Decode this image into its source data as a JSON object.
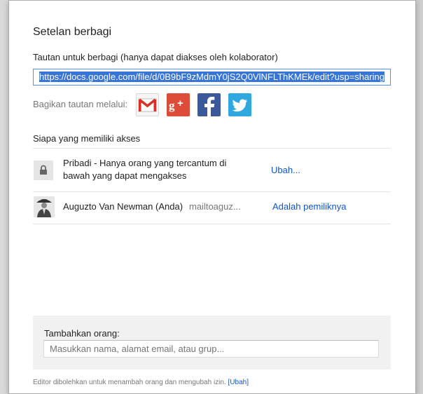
{
  "dialog": {
    "title": "Setelan berbagi",
    "link_label": "Tautan untuk berbagi (hanya dapat diakses oleh kolaborator)",
    "link_value": "https://docs.google.com/file/d/0B9bF9zMdmY0jS2Q0VlNFLThKMEk/edit?usp=sharing",
    "share_via_label": "Bagikan tautan melalui:",
    "share_icons": [
      "gmail-icon",
      "google-plus-icon",
      "facebook-icon",
      "twitter-icon"
    ],
    "access_title": "Siapa yang memiliki akses",
    "access_rows": [
      {
        "icon": "lock-icon",
        "text": "Pribadi - Hanya orang yang tercantum di bawah yang dapat mengakses",
        "action": "Ubah..."
      },
      {
        "icon": "avatar",
        "name": "Auguzto Van Newman (Anda)",
        "email": "mailtoaguz...",
        "action": "Adalah pemiliknya"
      }
    ],
    "add_people": {
      "label": "Tambahkan orang:",
      "placeholder": "Masukkan nama, alamat email, atau grup..."
    },
    "footer": {
      "text": "Editor dibolehkan untuk menambah orang dan mengubah izin.",
      "link": "[Ubah]"
    }
  },
  "colors": {
    "link_blue": "#1155cc",
    "selection_blue": "#3875d7",
    "gplus_red": "#dd4b39",
    "facebook_blue": "#3b5998",
    "twitter_blue": "#2fa8e0"
  }
}
